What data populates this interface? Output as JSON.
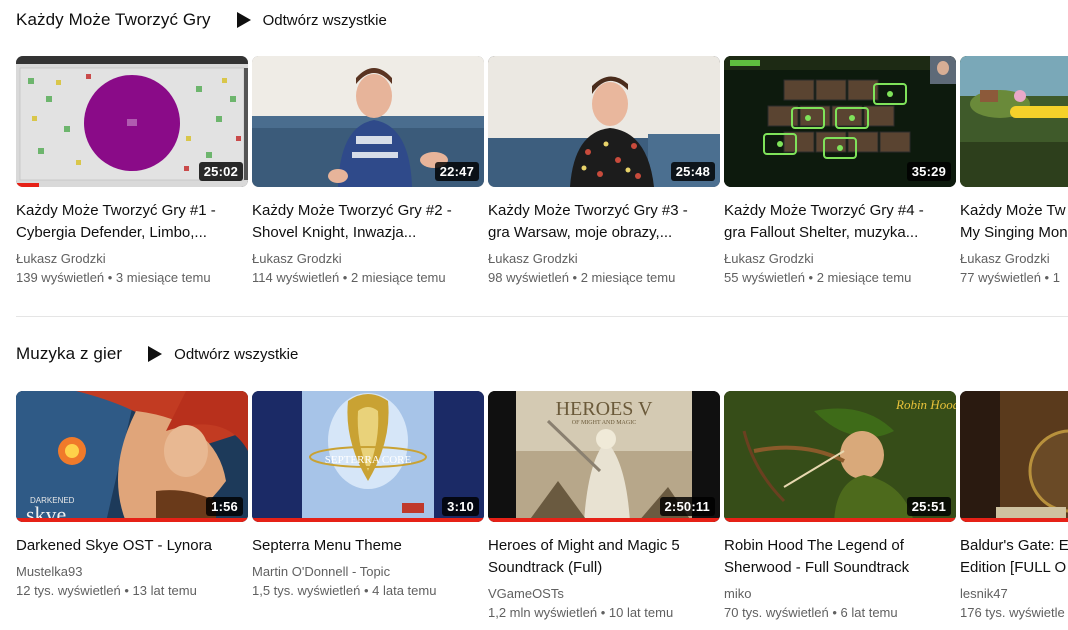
{
  "shelves": [
    {
      "title": "Każdy Może Tworzyć Gry",
      "play_all": "Odtwórz wszystkie",
      "videos": [
        {
          "title": "Każdy Może Tworzyć Gry #1 -\nCybergia Defender, Limbo,...",
          "channel": "Łukasz Grodzki",
          "meta": "139 wyświetleń • 3 miesiące temu",
          "duration": "25:02",
          "watched": 0.1
        },
        {
          "title": "Każdy Może Tworzyć Gry #2 -\nShovel Knight, Inwazja...",
          "channel": "Łukasz Grodzki",
          "meta": "114 wyświetleń • 2 miesiące temu",
          "duration": "22:47",
          "watched": 0
        },
        {
          "title": "Każdy Może Tworzyć Gry #3 -\ngra Warsaw, moje obrazy,...",
          "channel": "Łukasz Grodzki",
          "meta": "98 wyświetleń • 2 miesiące temu",
          "duration": "25:48",
          "watched": 0
        },
        {
          "title": "Każdy Może Tworzyć Gry #4 -\ngra Fallout Shelter, muzyka...",
          "channel": "Łukasz Grodzki",
          "meta": "55 wyświetleń • 2 miesiące temu",
          "duration": "35:29",
          "watched": 0
        },
        {
          "title": "Każdy Może Tw\nMy Singing Mon",
          "channel": "Łukasz Grodzki",
          "meta": "77 wyświetleń • 1",
          "duration": "",
          "watched": 0
        }
      ]
    },
    {
      "title": "Muzyka z gier",
      "play_all": "Odtwórz wszystkie",
      "videos": [
        {
          "title": "Darkened Skye OST - Lynora",
          "channel": "Mustelka93",
          "meta": "12 tys. wyświetleń • 13 lat temu",
          "duration": "1:56",
          "watched": 1.0
        },
        {
          "title": "Septerra Menu Theme",
          "channel": "Martin O'Donnell - Topic",
          "meta": "1,5 tys. wyświetleń • 4 lata temu",
          "duration": "3:10",
          "watched": 1.0
        },
        {
          "title": "Heroes of Might and Magic 5\nSoundtrack (Full)",
          "channel": "VGameOSTs",
          "meta": "1,2 mln wyświetleń • 10 lat temu",
          "duration": "2:50:11",
          "watched": 1.0
        },
        {
          "title": "Robin Hood The Legend of\nSherwood - Full Soundtrack",
          "channel": "miko",
          "meta": "70 tys. wyświetleń • 6 lat temu",
          "duration": "25:51",
          "watched": 1.0
        },
        {
          "title": "Baldur's Gate: E\nEdition [FULL O",
          "channel": "lesnik47",
          "meta": "176 tys. wyświetle",
          "duration": "",
          "watched": 1.0
        }
      ]
    }
  ],
  "thumb_text": {
    "darkened_skye": "DARKENED",
    "skye": "skye",
    "heroes": "HEROES V",
    "heroes_sub": "OF MIGHT AND MAGIC",
    "septerra": "SEPTERRA CORE",
    "robin_hood": "Robin Hood"
  },
  "colors": {
    "progress": "#e62117",
    "meta_text": "#606060"
  }
}
